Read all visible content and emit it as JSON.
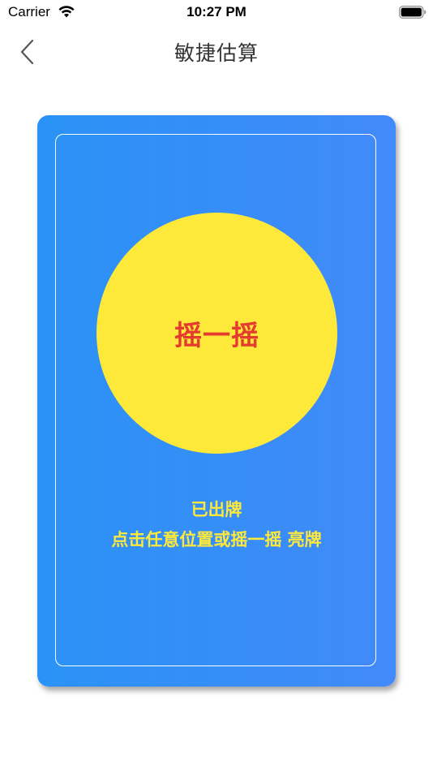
{
  "status_bar": {
    "carrier": "Carrier",
    "time": "10:27 PM",
    "wifi_icon": "wifi-icon",
    "battery_icon": "battery-icon"
  },
  "nav": {
    "title": "敏捷估算",
    "back_icon": "chevron-left-icon"
  },
  "card": {
    "shake_label": "摇一摇",
    "status": "已出牌",
    "hint": "点击任意位置或摇一摇 亮牌"
  },
  "colors": {
    "card_gradient_start": "#2a92f6",
    "card_gradient_end": "#428af9",
    "circle": "#fee93a",
    "shake_label": "#e53a2f",
    "card_text": "#fee93a"
  }
}
